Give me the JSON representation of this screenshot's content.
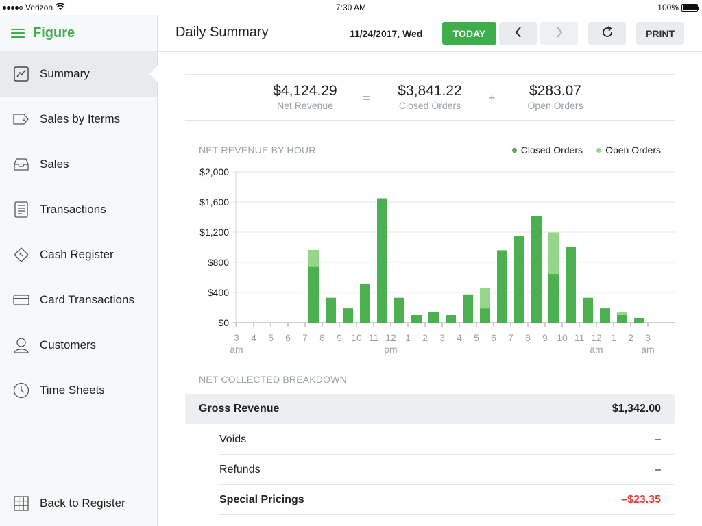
{
  "status": {
    "carrier": "Verizon",
    "time": "7:30 AM",
    "battery": "100%"
  },
  "sidebar": {
    "brand": "Figure",
    "items": [
      {
        "label": "Summary",
        "icon": "chart-icon"
      },
      {
        "label": "Sales by Iterms",
        "icon": "tag-icon"
      },
      {
        "label": "Sales",
        "icon": "tray-icon"
      },
      {
        "label": "Transactions",
        "icon": "document-icon"
      },
      {
        "label": "Cash Register",
        "icon": "ticket-icon"
      },
      {
        "label": "Card Transactions",
        "icon": "card-icon"
      },
      {
        "label": "Customers",
        "icon": "person-icon"
      },
      {
        "label": "Time Sheets",
        "icon": "clock-icon"
      }
    ],
    "bottom": {
      "label": "Back to Register",
      "icon": "grid-icon"
    }
  },
  "header": {
    "title": "Daily Summary",
    "date": "11/24/2017, Wed",
    "today_label": "TODAY",
    "print_label": "PRINT"
  },
  "summary": {
    "net_revenue": "$4,124.29",
    "net_revenue_label": "Net Revenue",
    "closed_orders": "$3,841.22",
    "closed_orders_label": "Closed Orders",
    "open_orders": "$283.07",
    "open_orders_label": "Open Orders",
    "equals": "=",
    "plus": "+"
  },
  "chart_section_label": "NET REVENUE BY HOUR",
  "chart_data": {
    "type": "bar",
    "stacked": true,
    "categories": [
      "3 am",
      "4",
      "5",
      "6",
      "7",
      "8",
      "9",
      "10",
      "11",
      "12 pm",
      "1",
      "2",
      "3",
      "4",
      "5",
      "6",
      "7",
      "8",
      "9",
      "10",
      "11",
      "12 am",
      "1",
      "2",
      "3 am"
    ],
    "series": [
      {
        "name": "Closed Orders",
        "color": "#4caf50",
        "values": [
          0,
          0,
          0,
          0,
          740,
          330,
          190,
          510,
          1650,
          330,
          100,
          140,
          100,
          375,
          190,
          960,
          1145,
          1415,
          645,
          1010,
          330,
          190,
          100,
          60,
          0
        ]
      },
      {
        "name": "Open Orders",
        "color": "#95d68a",
        "values": [
          0,
          0,
          0,
          0,
          225,
          0,
          0,
          0,
          0,
          0,
          0,
          0,
          0,
          0,
          270,
          0,
          0,
          0,
          550,
          0,
          0,
          0,
          45,
          0,
          0
        ]
      }
    ],
    "ylim": [
      0,
      2000
    ],
    "yticks": [
      0,
      400,
      800,
      1200,
      1600,
      2000
    ],
    "ytick_labels": [
      "$0",
      "$400",
      "$800",
      "$1,200",
      "$1,600",
      "$2,000"
    ],
    "xtick_labels": [
      {
        "top": "3",
        "bottom": "am"
      },
      {
        "top": "4",
        "bottom": ""
      },
      {
        "top": "5",
        "bottom": ""
      },
      {
        "top": "6",
        "bottom": ""
      },
      {
        "top": "7",
        "bottom": ""
      },
      {
        "top": "8",
        "bottom": ""
      },
      {
        "top": "9",
        "bottom": ""
      },
      {
        "top": "10",
        "bottom": ""
      },
      {
        "top": "11",
        "bottom": ""
      },
      {
        "top": "12",
        "bottom": "pm"
      },
      {
        "top": "1",
        "bottom": ""
      },
      {
        "top": "2",
        "bottom": ""
      },
      {
        "top": "3",
        "bottom": ""
      },
      {
        "top": "4",
        "bottom": ""
      },
      {
        "top": "5",
        "bottom": ""
      },
      {
        "top": "6",
        "bottom": ""
      },
      {
        "top": "7",
        "bottom": ""
      },
      {
        "top": "8",
        "bottom": ""
      },
      {
        "top": "9",
        "bottom": ""
      },
      {
        "top": "10",
        "bottom": ""
      },
      {
        "top": "11",
        "bottom": ""
      },
      {
        "top": "12",
        "bottom": "am"
      },
      {
        "top": "1",
        "bottom": ""
      },
      {
        "top": "2",
        "bottom": ""
      },
      {
        "top": "3",
        "bottom": "am"
      }
    ],
    "grid": true,
    "legend_position": "top-right"
  },
  "breakdown": {
    "label": "NET COLLECTED BREAKDOWN",
    "gross": {
      "label": "Gross Revenue",
      "value": "$1,342.00"
    },
    "voids": {
      "label": "Voids",
      "value": "–"
    },
    "refunds": {
      "label": "Refunds",
      "value": "–"
    },
    "special": {
      "label": "Special Pricings",
      "value": "–$23.35"
    }
  },
  "colors": {
    "accent": "#3eae4c",
    "closed": "#4caf50",
    "open": "#95d68a",
    "negative": "#e0413a"
  }
}
